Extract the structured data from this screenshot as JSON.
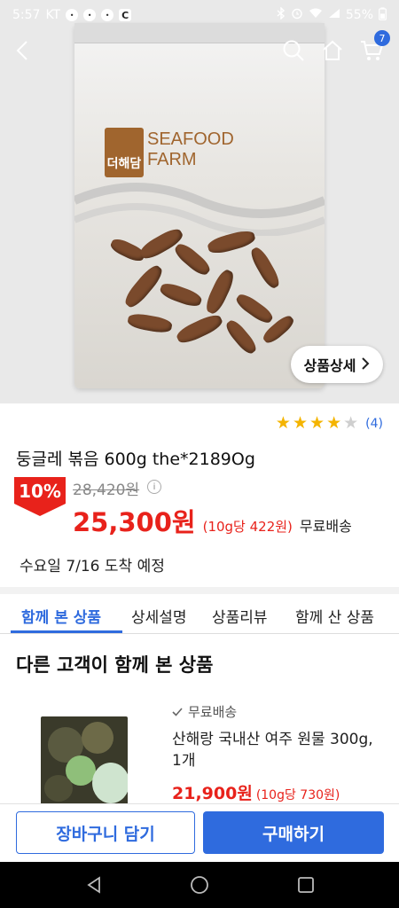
{
  "status_bar": {
    "time": "5:57",
    "carrier": "KT",
    "battery": "55%"
  },
  "header": {
    "cart_count": "7"
  },
  "hero": {
    "brand_logo_text": "더해담",
    "brand_name_line1": "SEAFOOD",
    "brand_name_line2": "FARM",
    "detail_button_label": "상품상세"
  },
  "product": {
    "rating": 4,
    "rating_max": 5,
    "review_count": "(4)",
    "title": "둥글레 볶음 600g the*2189Og",
    "discount": "10%",
    "original_price": "28,420원",
    "sale_price": "25,300원",
    "unit_price": "(10g당 422원)",
    "shipping": "무료배송",
    "delivery": "수요일 7/16 도착 예정"
  },
  "tabs": [
    {
      "label": "함께 본 상품",
      "active": true
    },
    {
      "label": "상세설명",
      "active": false
    },
    {
      "label": "상품리뷰",
      "active": false
    },
    {
      "label": "함께 산 상품",
      "active": false
    }
  ],
  "recommend": {
    "section_title": "다른 고객이 함께 본 상품",
    "items": [
      {
        "free_shipping": "무료배송",
        "name": "산해랑 국내산 여주 원물 300g, 1개",
        "price": "21,900원",
        "unit_price": "(10g당 730원)"
      }
    ]
  },
  "bottom_bar": {
    "cart_label": "장바구니 담기",
    "buy_label": "구매하기"
  },
  "colors": {
    "accent": "#2f6bde",
    "price_red": "#e8221b",
    "star": "#f4b400"
  }
}
